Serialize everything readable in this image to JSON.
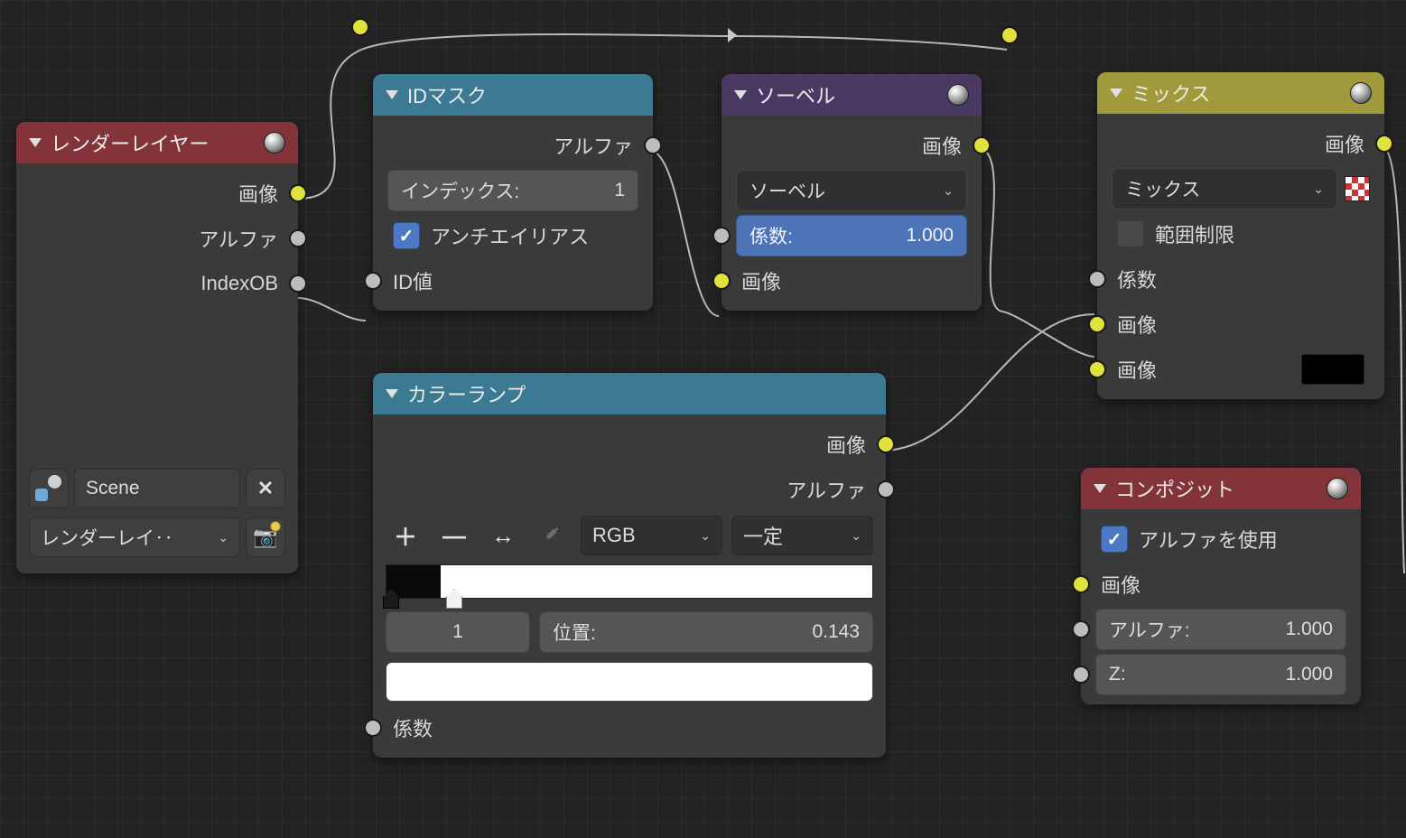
{
  "render_layers": {
    "title": "レンダーレイヤー",
    "out_image": "画像",
    "out_alpha": "アルファ",
    "out_indexob": "IndexOB",
    "scene_value": "Scene",
    "layer_value": "レンダーレイ‥"
  },
  "id_mask": {
    "title": "IDマスク",
    "out_alpha": "アルファ",
    "index_label": "インデックス:",
    "index_value": "1",
    "antialias_label": "アンチエイリアス",
    "in_idvalue": "ID値"
  },
  "sobel": {
    "title": "ソーベル",
    "out_image": "画像",
    "filter_value": "ソーベル",
    "fac_label": "係数:",
    "fac_value": "1.000",
    "in_image": "画像"
  },
  "color_ramp": {
    "title": "カラーランプ",
    "out_image": "画像",
    "out_alpha": "アルファ",
    "mode_value": "RGB",
    "interp_value": "一定",
    "stop_index": "1",
    "pos_label": "位置:",
    "pos_value": "0.143",
    "in_fac": "係数"
  },
  "mix": {
    "title": "ミックス",
    "out_image": "画像",
    "blend_value": "ミックス",
    "clamp_label": "範囲制限",
    "in_fac": "係数",
    "in_image1": "画像",
    "in_image2": "画像"
  },
  "composite": {
    "title": "コンポジット",
    "use_alpha_label": "アルファを使用",
    "in_image": "画像",
    "alpha_label": "アルファ:",
    "alpha_value": "1.000",
    "z_label": "Z:",
    "z_value": "1.000"
  }
}
